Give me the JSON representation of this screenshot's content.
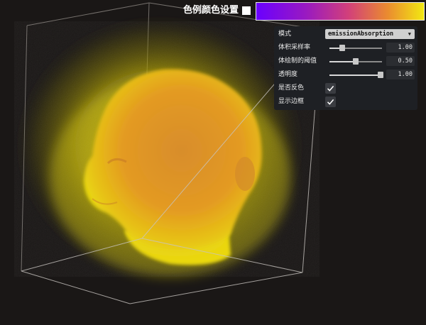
{
  "colors": {
    "background": "#1a1716",
    "volume_glow": "#e3d60f",
    "volume_head": "#eb9d26",
    "panel_bg": "#1e2024",
    "legend_gradient": [
      "#6a00ff",
      "#d2407a",
      "#f2e812"
    ]
  },
  "legend": {
    "title": "色例颜色设置"
  },
  "panel": {
    "mode": {
      "label": "模式",
      "value": "emissionAbsorption"
    },
    "sampling_rate": {
      "label": "体积采样率",
      "value": "1.00",
      "level": 0.24
    },
    "threshold": {
      "label": "体绘制的阈值",
      "value": "0.50",
      "level": 0.5
    },
    "opacity": {
      "label": "透明度",
      "value": "1.00",
      "level": 0.97
    },
    "invert": {
      "label": "是否反色",
      "checked": true
    },
    "show_box": {
      "label": "显示边框",
      "checked": true
    }
  }
}
